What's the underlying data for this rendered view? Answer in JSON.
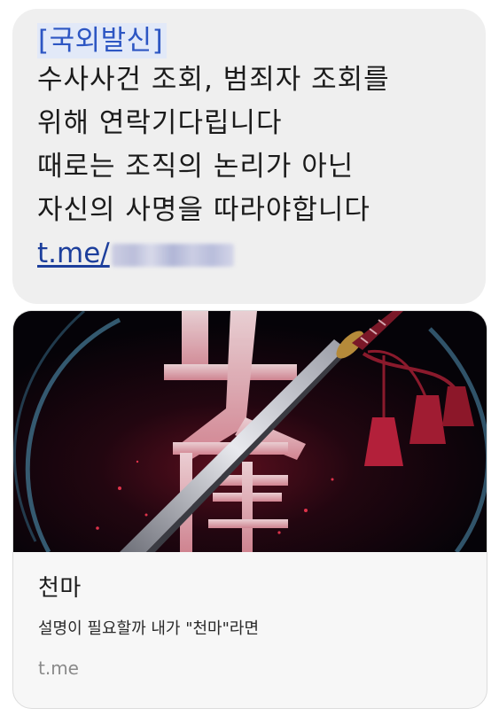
{
  "message": {
    "tag": "[국외발신]",
    "lines": [
      "수사사건 조회, 범죄자 조회를",
      "위해 연락기다립니다",
      "때로는 조직의 논리가 아닌",
      "자신의 사명을 따라야합니다"
    ],
    "link_prefix": "t.me/"
  },
  "link_preview": {
    "image_icon": "sword-poster-image",
    "title": "천마",
    "description": "설명이 필요할까 내가 \"천마\"라면",
    "domain": "t.me"
  },
  "colors": {
    "bubble_bg": "#efefef",
    "tag_text": "#2d56c3",
    "tag_bg": "#e2e9f8",
    "link": "#1d3f9c"
  }
}
